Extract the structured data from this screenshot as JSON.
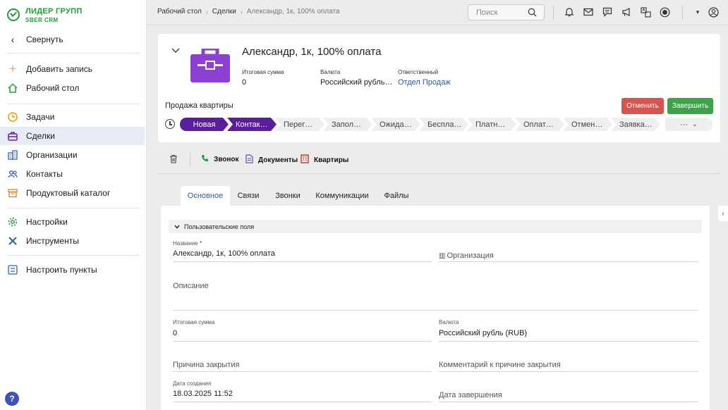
{
  "brand": {
    "name": "ЛИДЕР ГРУПП",
    "sub": "SBER CRM",
    "color": "#21a038"
  },
  "sidebar": {
    "collapse": "Свернуть",
    "items": [
      {
        "label": "Добавить запись",
        "icon": "plus-icon"
      },
      {
        "label": "Рабочий стол",
        "icon": "home-icon"
      },
      {
        "label": "Задачи",
        "icon": "clock-icon"
      },
      {
        "label": "Сделки",
        "icon": "briefcase-icon"
      },
      {
        "label": "Организации",
        "icon": "building-icon"
      },
      {
        "label": "Контакты",
        "icon": "people-icon"
      },
      {
        "label": "Продуктовый каталог",
        "icon": "box-icon"
      },
      {
        "label": "Настройки",
        "icon": "gear-icon"
      },
      {
        "label": "Инструменты",
        "icon": "tools-icon"
      },
      {
        "label": "Настроить пункты",
        "icon": "settings-list-icon"
      }
    ],
    "help": "?"
  },
  "topbar": {
    "breadcrumb": [
      "Рабочий стол",
      "Сделки",
      "Александр, 1к, 100% оплата"
    ],
    "search_placeholder": "Поиск"
  },
  "deal": {
    "title": "Александр, 1к, 100% оплата",
    "total_label": "Итоговая сумма",
    "total_value": "0",
    "currency_label": "Валюта",
    "currency_value": "Российский рубль…",
    "owner_label": "Ответственный",
    "owner_value": "Отдел Продаж",
    "pipeline": "Продажа квартиры",
    "cancel_label": "Отменить",
    "finish_label": "Завершить",
    "accent": "#5b1d9c",
    "stages": [
      "Новая",
      "Контак…",
      "Перег…",
      "Запол…",
      "Ожида…",
      "Беспла…",
      "Платн…",
      "Оплат…",
      "Отмен…",
      "Заявка…"
    ],
    "stages_done": 2,
    "more": "···"
  },
  "toolbar": {
    "call": "Звонок",
    "docs": "Документы",
    "flats": "Квартиры"
  },
  "tabs": [
    "Основное",
    "Связи",
    "Звонки",
    "Коммуникации",
    "Файлы"
  ],
  "form": {
    "section": "Пользовательские поля",
    "name_label": "Название",
    "name_req": "*",
    "name_value": "Александр, 1к, 100% оплата",
    "org_label": "Организация",
    "desc_label": "Описание",
    "total_label": "Итоговая сумма",
    "total_value": "0",
    "currency_label": "Валюта",
    "currency_value": "Российский рубль (RUB)",
    "close_reason_label": "Причина закрытия",
    "close_comment_label": "Комментарий к причине закрытия",
    "created_label": "Дата создания",
    "created_value": "18.03.2025 11:52",
    "finished_label": "Дата завершения"
  }
}
